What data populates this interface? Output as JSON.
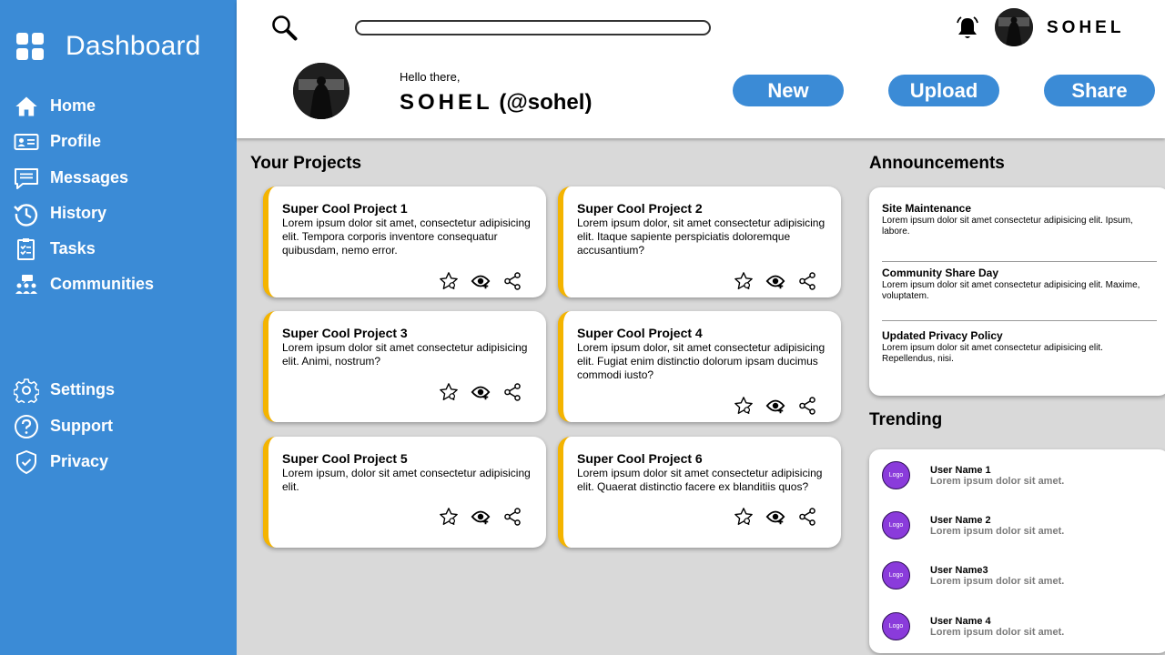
{
  "sidebar": {
    "title": "Dashboard",
    "nav": [
      {
        "label": "Home",
        "icon": "home-icon"
      },
      {
        "label": "Profile",
        "icon": "profile-card-icon"
      },
      {
        "label": "Messages",
        "icon": "message-icon"
      },
      {
        "label": "History",
        "icon": "history-icon"
      },
      {
        "label": "Tasks",
        "icon": "tasks-icon"
      },
      {
        "label": "Communities",
        "icon": "communities-icon"
      }
    ],
    "bottom_nav": [
      {
        "label": "Settings",
        "icon": "gear-icon"
      },
      {
        "label": "Support",
        "icon": "question-icon"
      },
      {
        "label": "Privacy",
        "icon": "shield-icon"
      }
    ]
  },
  "header": {
    "search_placeholder": "",
    "username": "SOHEL",
    "greeting": "Hello there,",
    "display_name": "SOHEL",
    "handle": "(@sohel)",
    "buttons": {
      "new": "New",
      "upload": "Upload",
      "share": "Share"
    }
  },
  "projects": {
    "title": "Your Projects",
    "items": [
      {
        "title": "Super Cool Project 1",
        "desc": "Lorem ipsum dolor sit amet, consectetur adipisicing elit. Tempora corporis inventore consequatur quibusdam, nemo error."
      },
      {
        "title": "Super Cool Project 2",
        "desc": "Lorem ipsum dolor, sit amet consectetur adipisicing elit. Itaque sapiente perspiciatis doloremque accusantium?"
      },
      {
        "title": "Super Cool Project 3",
        "desc": "Lorem ipsum dolor sit amet consectetur adipisicing elit. Animi, nostrum?"
      },
      {
        "title": "Super Cool Project 4",
        "desc": "Lorem ipsum dolor, sit amet consectetur adipisicing elit. Fugiat enim distinctio dolorum ipsam ducimus commodi iusto?"
      },
      {
        "title": "Super Cool Project 5",
        "desc": "Lorem ipsum, dolor sit amet consectetur adipisicing elit."
      },
      {
        "title": "Super Cool Project 6",
        "desc": "Lorem ipsum dolor sit amet consectetur adipisicing elit. Quaerat distinctio facere ex blanditiis quos?"
      }
    ]
  },
  "announcements": {
    "title": "Announcements",
    "items": [
      {
        "title": "Site Maintenance",
        "desc": "Lorem ipsum dolor sit amet consectetur adipisicing elit. Ipsum, labore."
      },
      {
        "title": "Community Share Day",
        "desc": "Lorem ipsum dolor sit amet consectetur adipisicing elit. Maxime, voluptatem."
      },
      {
        "title": "Updated Privacy Policy",
        "desc": "Lorem ipsum dolor sit amet consectetur adipisicing elit. Repellendus, nisi."
      }
    ]
  },
  "trending": {
    "title": "Trending",
    "items": [
      {
        "logo": "Logo",
        "name": "User Name 1",
        "sub": "Lorem ipsum dolor sit amet."
      },
      {
        "logo": "Logo",
        "name": "User Name 2",
        "sub": "Lorem ipsum dolor sit amet."
      },
      {
        "logo": "Logo",
        "name": "User Name3",
        "sub": "Lorem ipsum dolor sit amet."
      },
      {
        "logo": "Logo",
        "name": "User Name 4",
        "sub": "Lorem ipsum dolor sit amet."
      }
    ]
  },
  "colors": {
    "sidebar": "#3b8bd6",
    "accent": "#f4b400",
    "logo_badge": "#8a3bdb",
    "background": "#d9d9d9"
  }
}
